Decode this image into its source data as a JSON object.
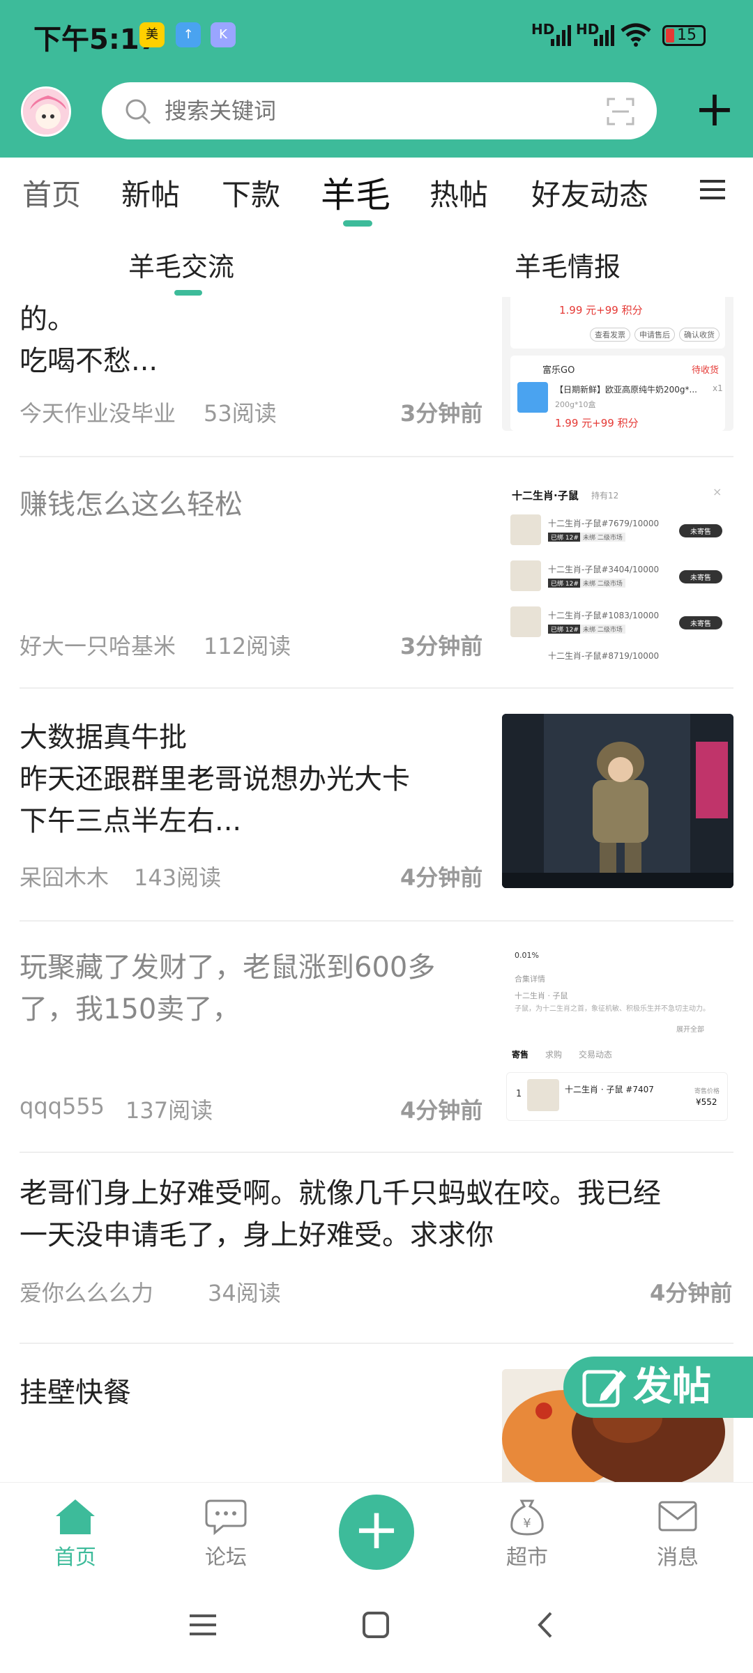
{
  "status_bar": {
    "time": "下午5:17",
    "battery": "15",
    "signal1": "HD",
    "signal2": "HD",
    "colors": {
      "accent": "#3dbb9a",
      "battery_low": "#e53935"
    }
  },
  "header": {
    "search_placeholder": "搜索关键词"
  },
  "tabs": [
    "首页",
    "新帖",
    "下款",
    "羊毛",
    "热帖",
    "好友动态"
  ],
  "active_tab": "羊毛",
  "subtabs": [
    "羊毛交流",
    "羊毛情报"
  ],
  "posts": [
    {
      "title_lines": [
        "的。",
        "吃喝不愁..."
      ],
      "author": "今天作业没毕业",
      "reads": "53阅读",
      "time": "3分钟前"
    },
    {
      "title_lines": [
        "赚钱怎么这么轻松"
      ],
      "author": "好大一只哈基米",
      "reads": "112阅读",
      "time": "3分钟前"
    },
    {
      "title_lines": [
        "大数据真牛批",
        "昨天还跟群里老哥说想办光大卡",
        "下午三点半左右..."
      ],
      "author": "呆囧木木",
      "reads": "143阅读",
      "time": "4分钟前"
    },
    {
      "title_lines": [
        "玩聚藏了发财了，老鼠涨到600多",
        "了，我150卖了，"
      ],
      "author": "qqq555",
      "reads": "137阅读",
      "time": "4分钟前"
    },
    {
      "title_lines": [
        "老哥们身上好难受啊。就像几千只蚂蚁在咬。我已经",
        "一天没申请毛了，身上好难受。求求你"
      ],
      "author": "爱你么么么力",
      "reads": "34阅读",
      "time": "4分钟前"
    },
    {
      "title_lines": [
        "挂壁快餐"
      ],
      "author": "",
      "reads": "",
      "time": ""
    }
  ],
  "thumb1": {
    "price": "1.99 元+99 积分",
    "btn1": "查看发票",
    "btn2": "申请售后",
    "btn3": "确认收货",
    "shop": "富乐GO",
    "shop_status": "待收货",
    "product": "【日期新鲜】欧亚高原纯牛奶200g*...",
    "spec": "200g*10盒",
    "qty": "x1",
    "price2": "1.99 元+99 积分"
  },
  "thumb2": {
    "header": "十二生肖·子鼠",
    "header_sub": "持有12",
    "items": [
      "十二生肖-子鼠#7679/10000",
      "十二生肖-子鼠#3404/10000",
      "十二生肖-子鼠#1083/10000",
      "十二生肖-子鼠#8719/10000"
    ],
    "tag1": "已绑 12#",
    "tag2": "未绑 二级市场",
    "btn": "未寄售"
  },
  "thumb4": {
    "pct": "0.01%",
    "label": "合集详情",
    "name": "十二生肖 · 子鼠",
    "desc": "子鼠，为十二生肖之首，象征机敏、积极乐生并不急切主动力。",
    "expand": "展开全部",
    "tabs": [
      "寄售",
      "求购",
      "交易动态"
    ],
    "row_idx": "1",
    "row_name": "十二生肖 · 子鼠 #7407",
    "row_label": "寄售价格",
    "row_price": "¥552"
  },
  "fab_label": "发帖",
  "bottom_nav": [
    "首页",
    "论坛",
    "超市",
    "消息"
  ],
  "bottom_icons": [
    "home-icon",
    "chat-icon",
    "money-bag-icon",
    "mail-icon"
  ]
}
